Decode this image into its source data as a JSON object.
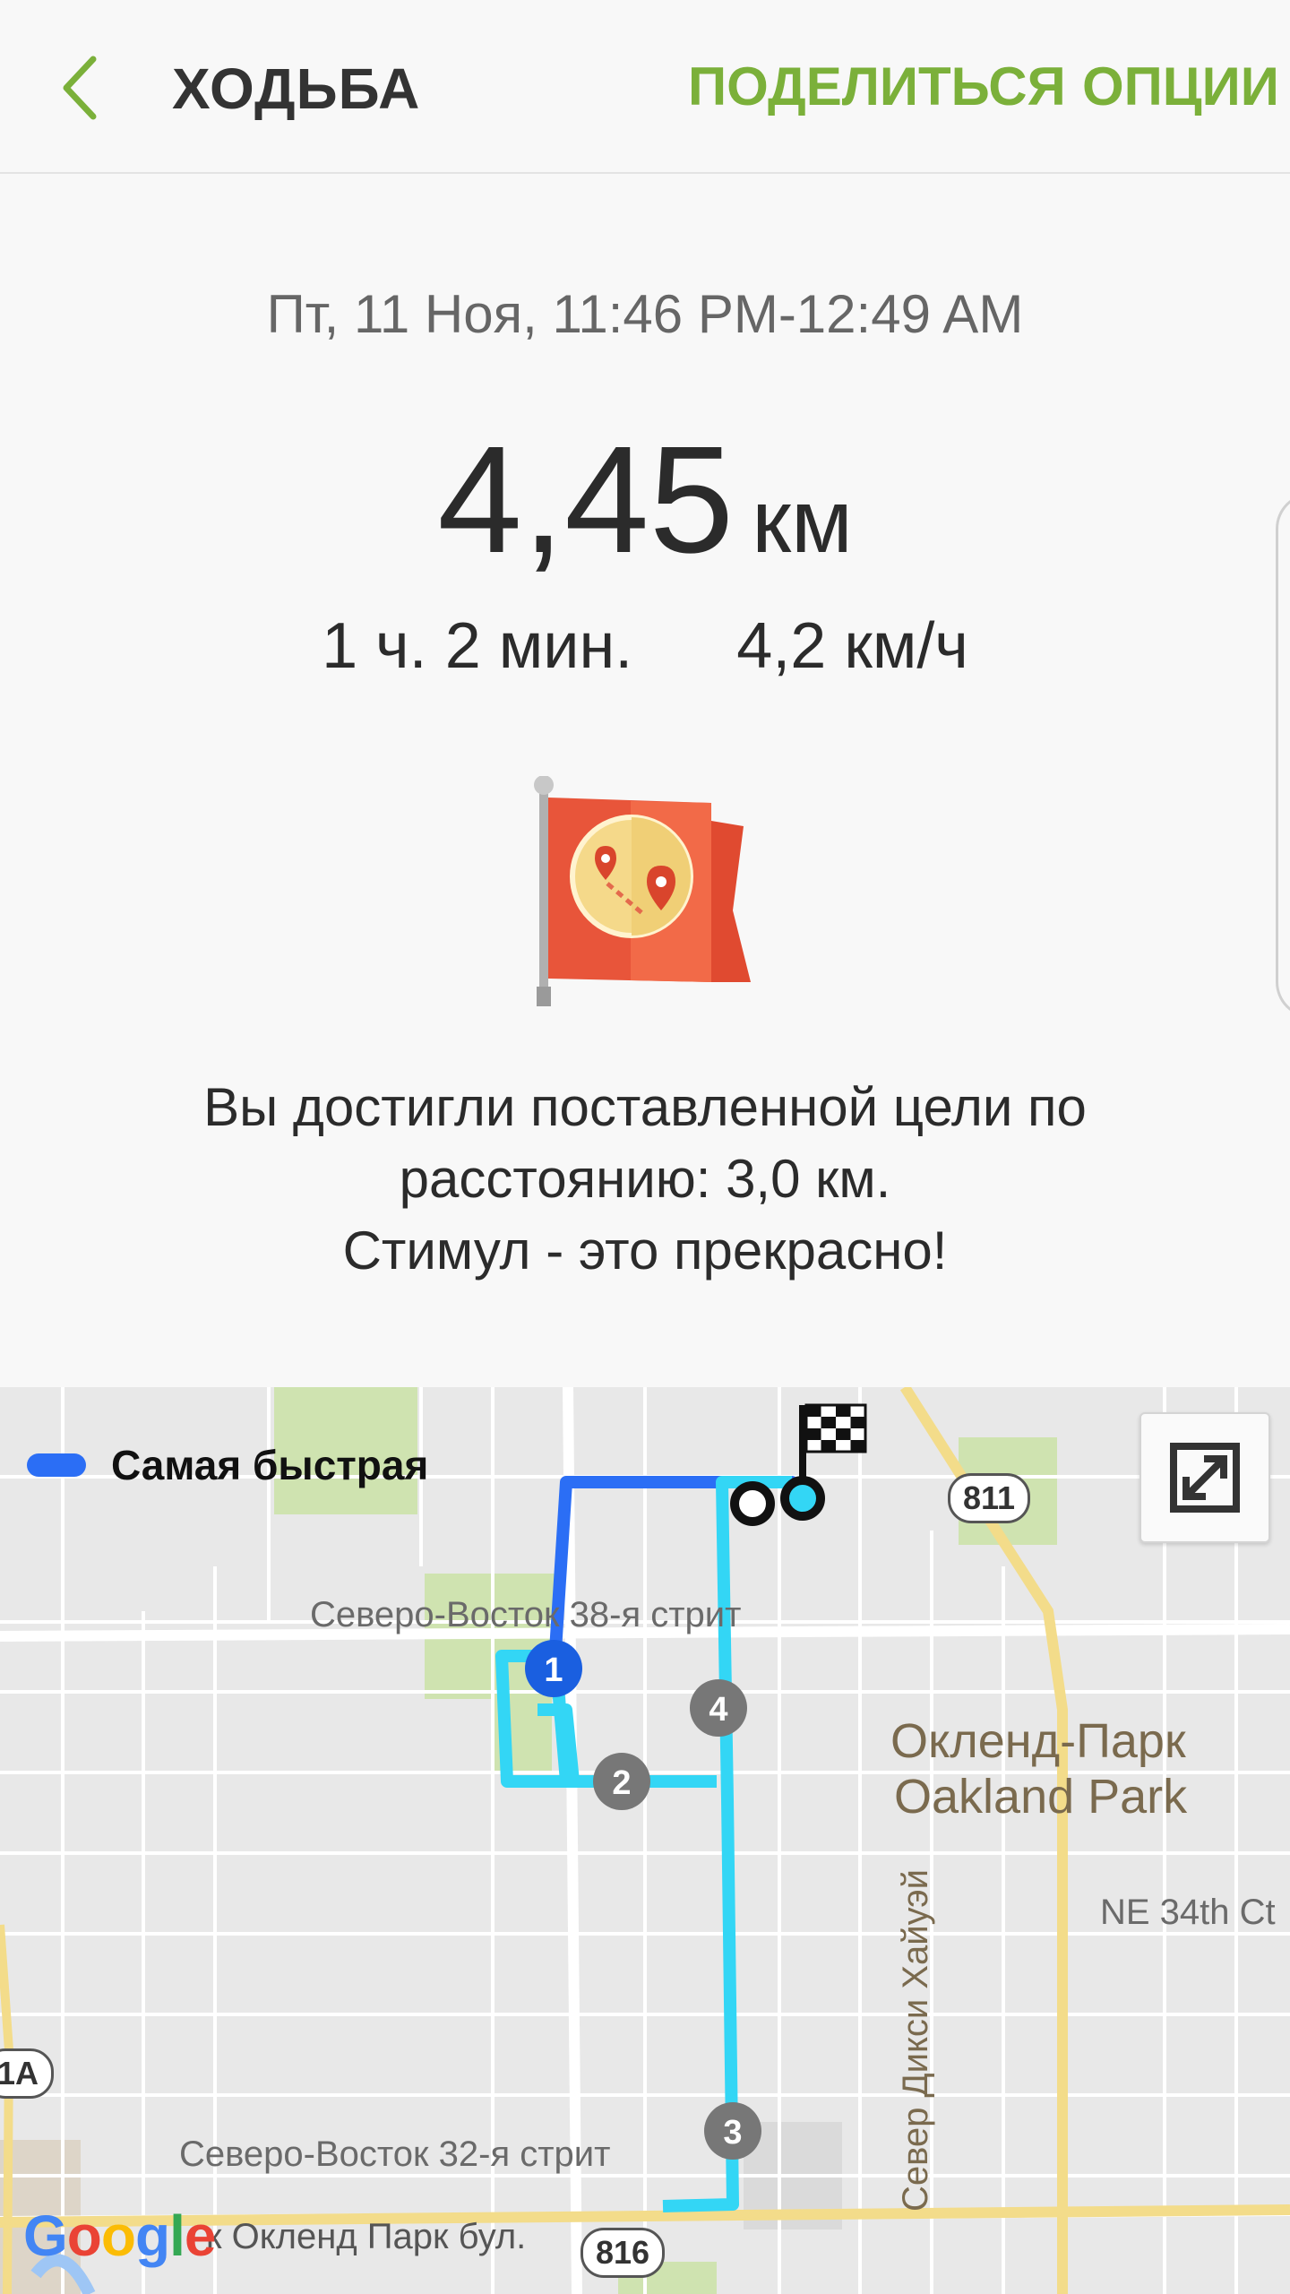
{
  "header": {
    "title": "ХОДЬБА",
    "share_label": "ПОДЕЛИТЬСЯ",
    "options_label": "ОПЦИИ"
  },
  "summary": {
    "date": "Пт, 11 Ноя, 11:46 PM-12:49 AM",
    "distance_value": "4,45",
    "distance_unit": "км",
    "duration": "1 ч. 2 мин.",
    "speed": "4,2 км/ч",
    "goal_line1": "Вы достигли поставленной цели по",
    "goal_line2": "расстоянию: 3,0 км.",
    "goal_line3": "Стимул - это прекрасно!"
  },
  "map": {
    "legend_label": "Самая быстрая",
    "route_color": "#2b6ef5",
    "track_color": "#33d6f5",
    "markers": [
      "1",
      "2",
      "3",
      "4"
    ],
    "street_labels": {
      "ne38": "Северо-Восток 38-я стрит",
      "ne32": "Северо-Восток 32-я стрит",
      "oakland_blvd_partial": "к Окленд Парк бул.",
      "dixie": "Север Дикси Хайуэй",
      "ne34": "NE 34th Ct"
    },
    "place_labels": {
      "ru": "Окленд-Парк",
      "en": "Oakland Park"
    },
    "road_badges": {
      "r811": "811",
      "r816": "816",
      "r1a": "1A"
    },
    "logo": [
      "G",
      "o",
      "o",
      "g",
      "l",
      "e"
    ]
  }
}
